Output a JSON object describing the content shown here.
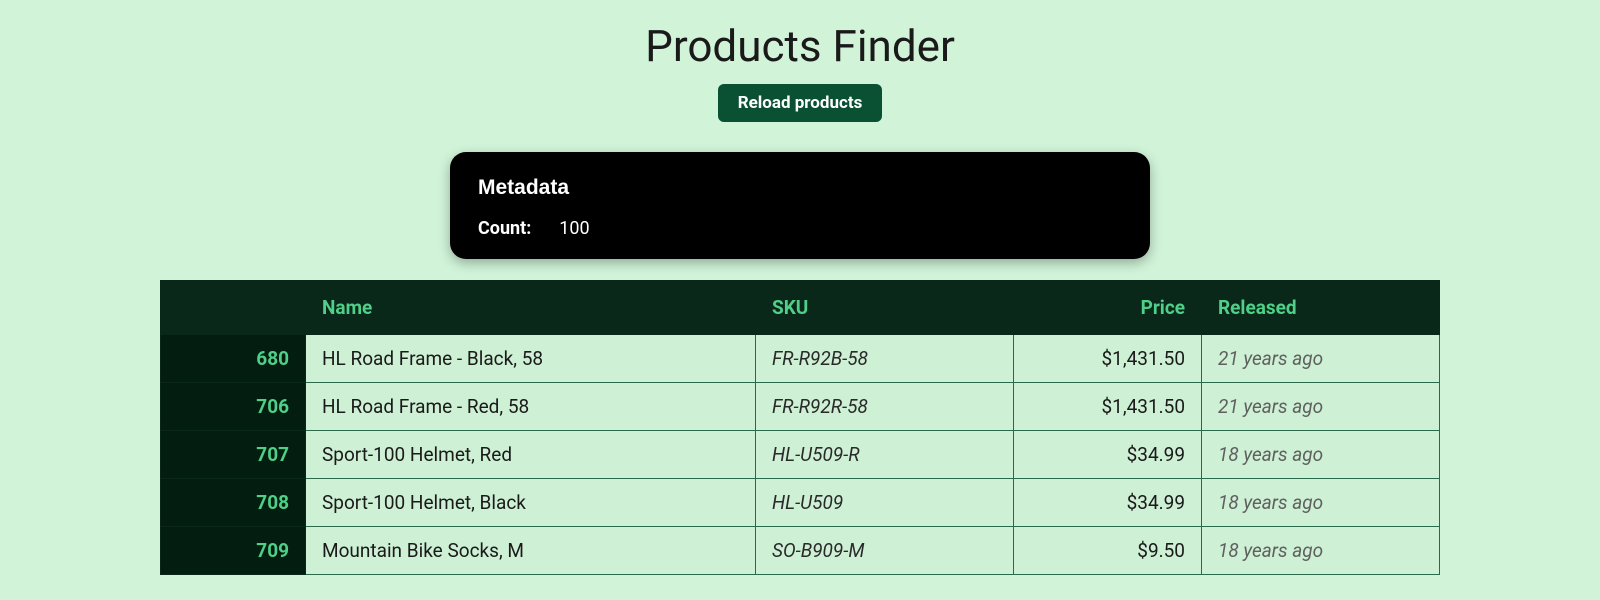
{
  "header": {
    "title": "Products Finder",
    "reload_label": "Reload products"
  },
  "metadata": {
    "title": "Metadata",
    "count_label": "Count:",
    "count_value": "100"
  },
  "table": {
    "headers": {
      "id": "",
      "name": "Name",
      "sku": "SKU",
      "price": "Price",
      "released": "Released"
    },
    "rows": [
      {
        "id": "680",
        "name": "HL Road Frame - Black, 58",
        "sku": "FR-R92B-58",
        "price": "$1,431.50",
        "released": "21 years ago"
      },
      {
        "id": "706",
        "name": "HL Road Frame - Red, 58",
        "sku": "FR-R92R-58",
        "price": "$1,431.50",
        "released": "21 years ago"
      },
      {
        "id": "707",
        "name": "Sport-100 Helmet, Red",
        "sku": "HL-U509-R",
        "price": "$34.99",
        "released": "18 years ago"
      },
      {
        "id": "708",
        "name": "Sport-100 Helmet, Black",
        "sku": "HL-U509",
        "price": "$34.99",
        "released": "18 years ago"
      },
      {
        "id": "709",
        "name": "Mountain Bike Socks, M",
        "sku": "SO-B909-M",
        "price": "$9.50",
        "released": "18 years ago"
      }
    ]
  }
}
